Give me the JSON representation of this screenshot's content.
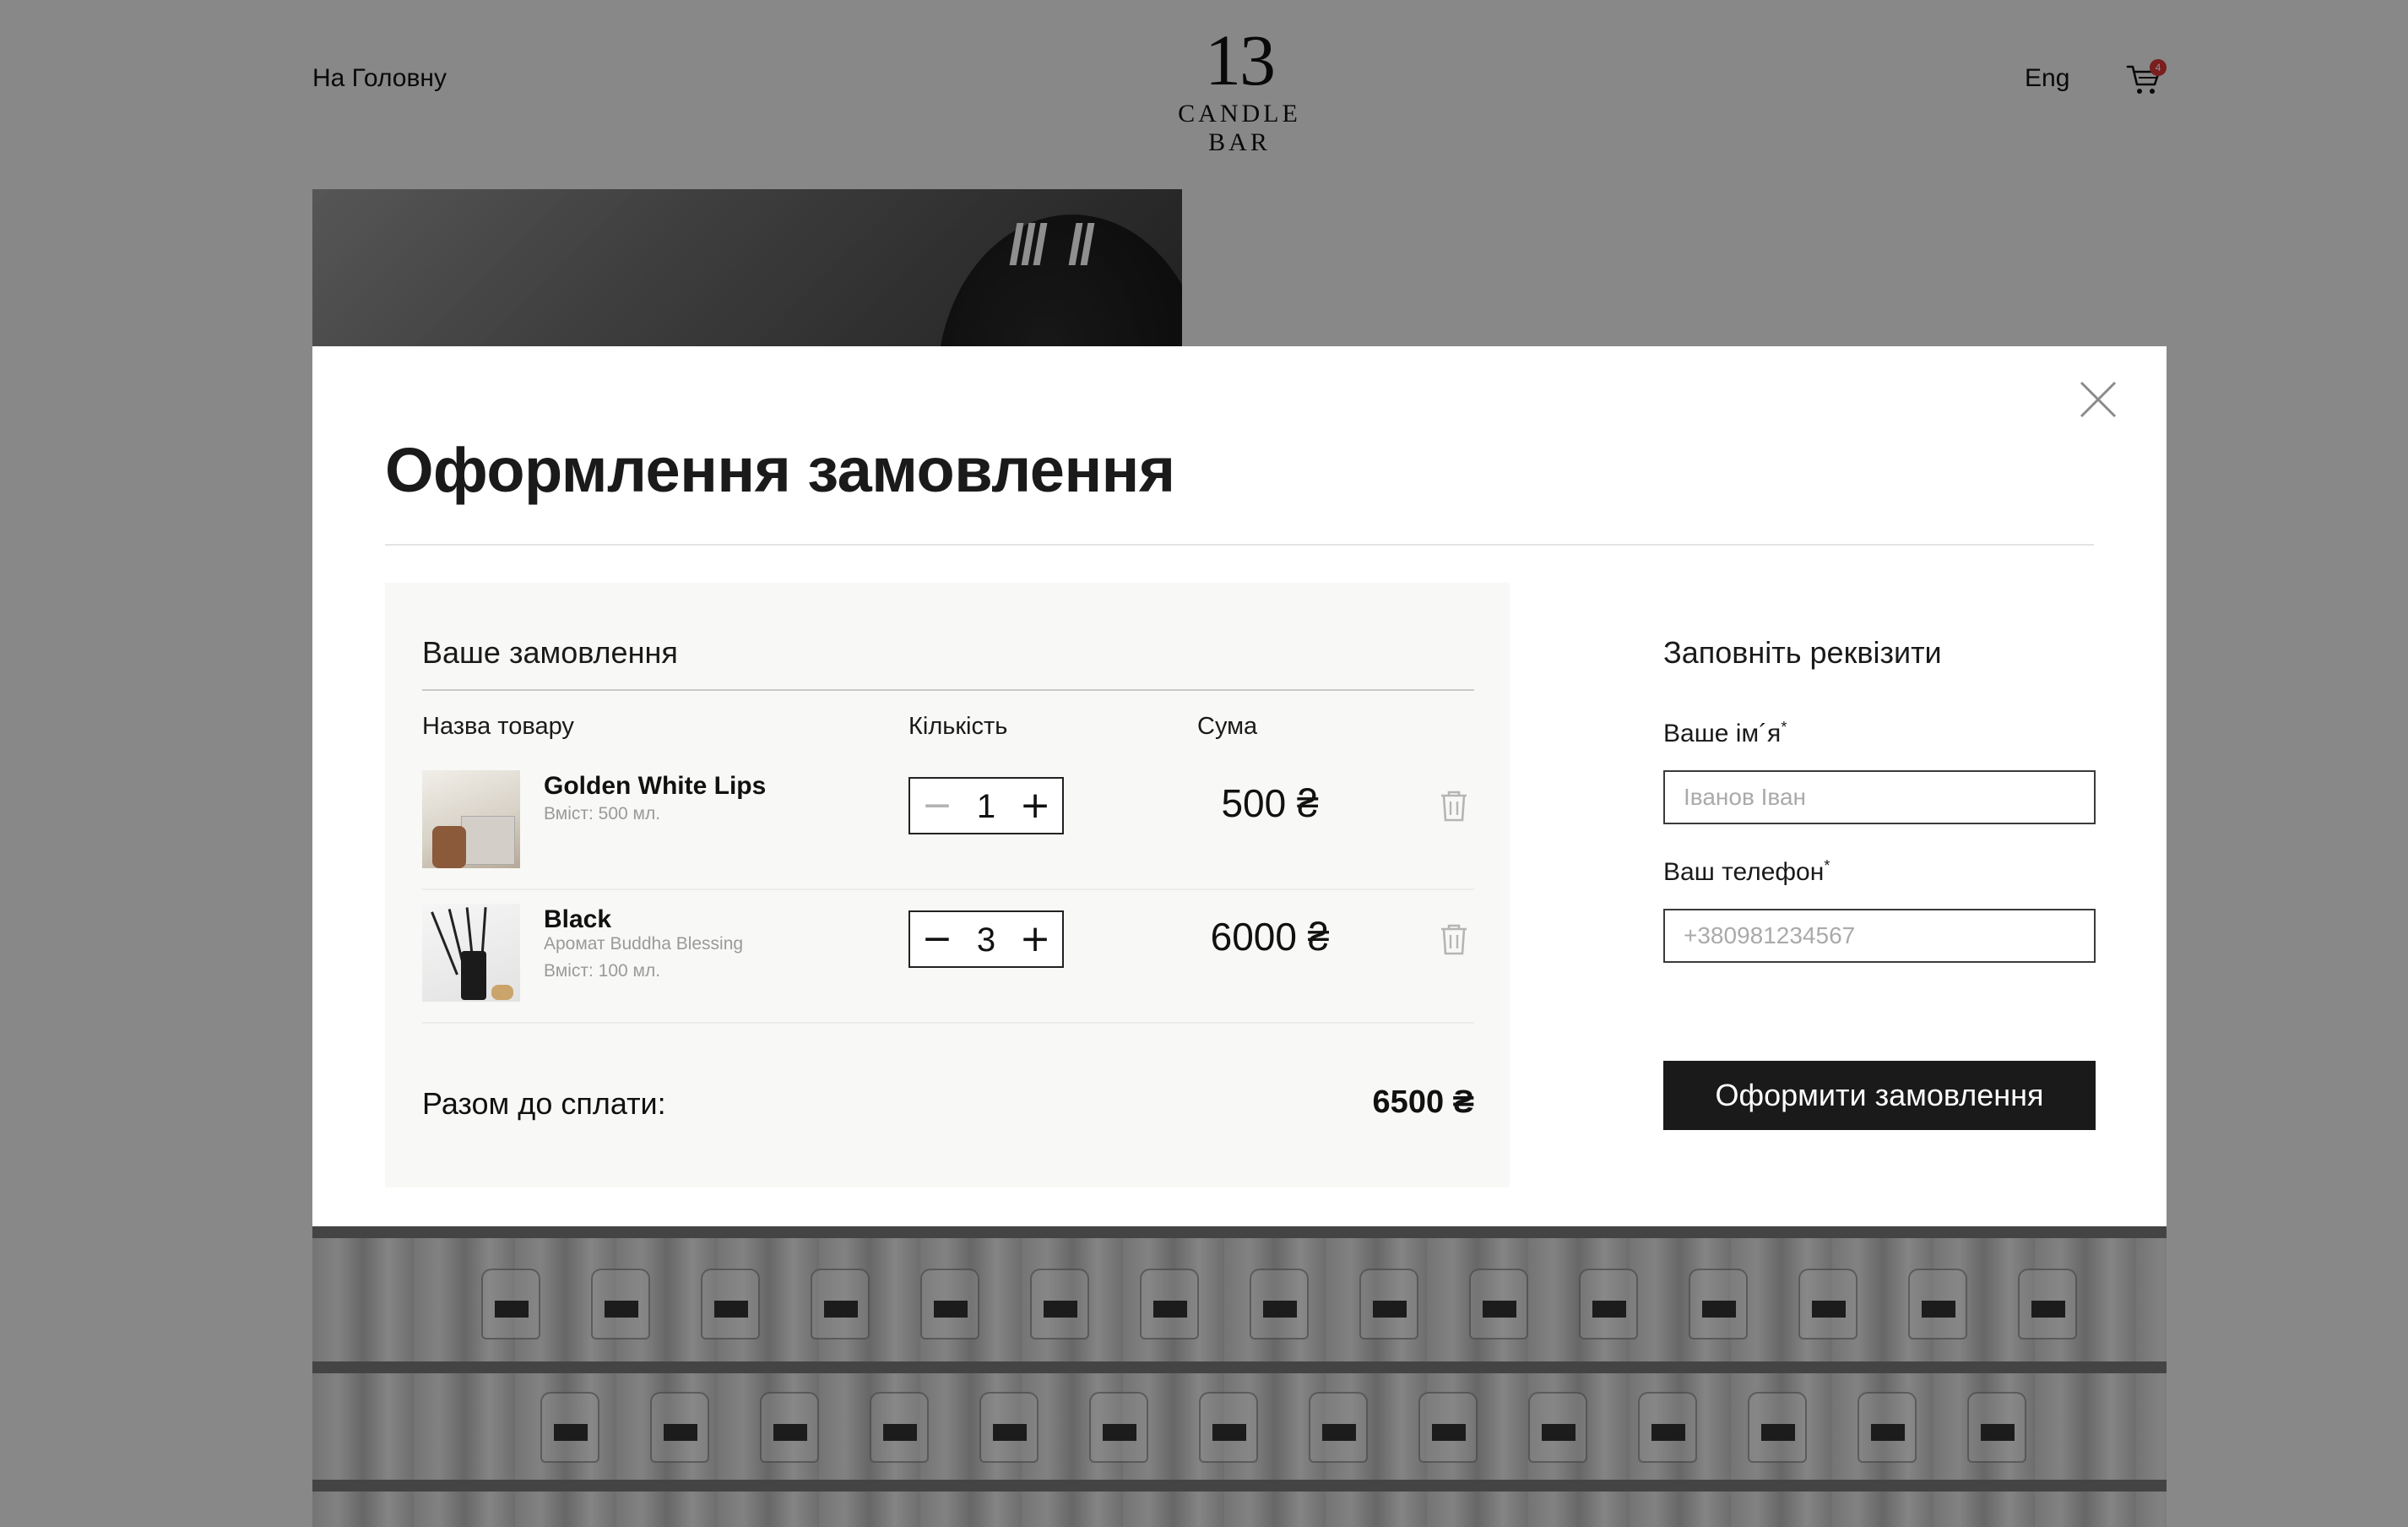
{
  "header": {
    "home_link": "На Головну",
    "logo_number": "13",
    "logo_text": "CANDLE BAR",
    "lang": "Eng",
    "cart_count": "4"
  },
  "modal": {
    "title": "Оформлення замовлення",
    "order": {
      "title": "Ваше замовлення",
      "columns": {
        "name": "Назва товару",
        "qty": "Кількість",
        "sum": "Сума"
      },
      "items": [
        {
          "name": "Golden White Lips",
          "details": [
            "Вміст: 500 мл."
          ],
          "qty": "1",
          "sum": "500 ₴"
        },
        {
          "name": "Black",
          "details": [
            "Аромат Buddha Blessing",
            "Вміст: 100 мл."
          ],
          "qty": "3",
          "sum": "6000 ₴"
        }
      ],
      "total_label": "Разом до сплати:",
      "total_value": "6500 ₴"
    },
    "form": {
      "title": "Заповніть реквізити",
      "name_label": "Ваше ім´я",
      "name_placeholder": "Іванов Іван",
      "phone_label": "Ваш телефон",
      "phone_placeholder": "+380981234567",
      "required_mark": "*",
      "submit_label": "Оформити замовлення"
    }
  },
  "colors": {
    "accent": "#1a1a1a",
    "overlay": "rgba(0,0,0,0.44)",
    "badge": "#d93636"
  }
}
